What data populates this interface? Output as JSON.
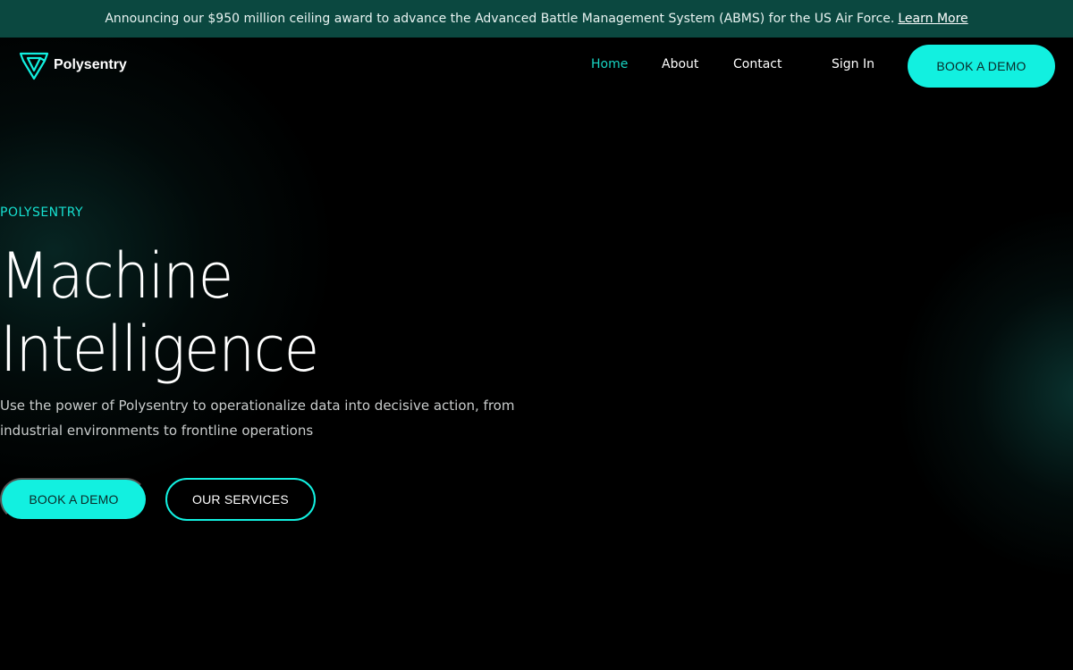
{
  "announcement": {
    "text": "Announcing our $950 million ceiling award to advance the Advanced Battle Management System (ABMS) for the US Air Force.",
    "link_label": "Learn More"
  },
  "brand": {
    "name": "Polysentry",
    "logo_icon": "shield-triangle-logo-icon",
    "accent_color": "#12f0e0"
  },
  "nav": {
    "items": [
      {
        "label": "Home",
        "active": true
      },
      {
        "label": "About",
        "active": false
      },
      {
        "label": "Contact",
        "active": false
      }
    ],
    "sign_in": "Sign In",
    "cta_label": "BOOK A DEMO"
  },
  "hero": {
    "eyebrow": "POLYSENTRY",
    "title_line1": "Machine",
    "title_line2": "Intelligence",
    "subtitle": "Use the power of Polysentry to operationalize data into decisive action, from industrial environments to frontline operations",
    "primary_button": "BOOK A DEMO",
    "secondary_button": "OUR SERVICES"
  },
  "colors": {
    "announcement_bg": "#0b4840",
    "background": "#000000",
    "active_nav": "#18d4c3"
  }
}
